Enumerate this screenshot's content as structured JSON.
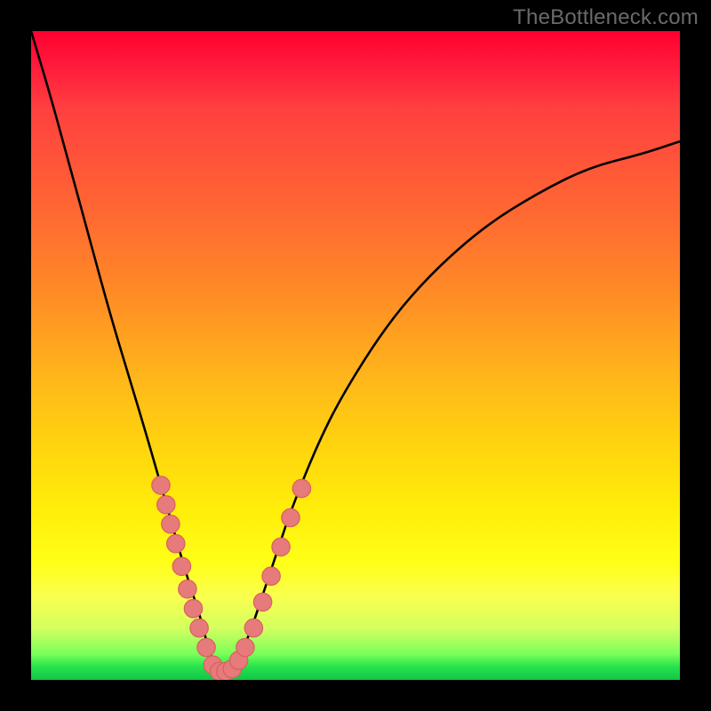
{
  "watermark": "TheBottleneck.com",
  "chart_data": {
    "type": "line",
    "title": "",
    "xlabel": "",
    "ylabel": "",
    "xlim": [
      0,
      100
    ],
    "ylim": [
      0,
      100
    ],
    "grid": false,
    "legend": false,
    "background": {
      "type": "vertical-gradient",
      "stops": [
        {
          "pos": 0.0,
          "color": "#ff002f"
        },
        {
          "pos": 0.4,
          "color": "#ff8a26"
        },
        {
          "pos": 0.74,
          "color": "#ffee0a"
        },
        {
          "pos": 0.92,
          "color": "#d4ff60"
        },
        {
          "pos": 1.0,
          "color": "#12c646"
        }
      ]
    },
    "series": [
      {
        "name": "bottleneck-curve",
        "stroke": "#000000",
        "x": [
          0,
          3,
          6,
          9,
          12,
          15,
          18,
          20,
          22,
          24,
          26,
          27,
          28,
          29,
          30,
          32,
          34,
          36,
          38,
          40,
          44,
          48,
          55,
          62,
          70,
          78,
          86,
          94,
          100
        ],
        "y_pct": [
          100,
          90,
          79,
          68,
          57,
          47,
          37,
          30,
          23,
          16,
          10,
          6,
          3,
          1,
          1,
          3,
          8,
          14,
          20,
          26,
          36,
          44,
          55,
          63,
          70,
          75,
          79,
          81,
          83
        ]
      }
    ],
    "markers": {
      "name": "sample-points",
      "color": "#e77a7a",
      "stroke": "#d86060",
      "radius_pct": 1.4,
      "points": [
        {
          "x": 20.0,
          "y_pct": 30.0
        },
        {
          "x": 20.8,
          "y_pct": 27.0
        },
        {
          "x": 21.5,
          "y_pct": 24.0
        },
        {
          "x": 22.3,
          "y_pct": 21.0
        },
        {
          "x": 23.2,
          "y_pct": 17.5
        },
        {
          "x": 24.1,
          "y_pct": 14.0
        },
        {
          "x": 25.0,
          "y_pct": 11.0
        },
        {
          "x": 25.9,
          "y_pct": 8.0
        },
        {
          "x": 27.0,
          "y_pct": 5.0
        },
        {
          "x": 28.0,
          "y_pct": 2.3
        },
        {
          "x": 29.0,
          "y_pct": 1.3
        },
        {
          "x": 30.0,
          "y_pct": 1.3
        },
        {
          "x": 31.0,
          "y_pct": 1.7
        },
        {
          "x": 32.0,
          "y_pct": 3.0
        },
        {
          "x": 33.0,
          "y_pct": 5.0
        },
        {
          "x": 34.3,
          "y_pct": 8.0
        },
        {
          "x": 35.7,
          "y_pct": 12.0
        },
        {
          "x": 37.0,
          "y_pct": 16.0
        },
        {
          "x": 38.5,
          "y_pct": 20.5
        },
        {
          "x": 40.0,
          "y_pct": 25.0
        },
        {
          "x": 41.7,
          "y_pct": 29.5
        }
      ]
    }
  }
}
